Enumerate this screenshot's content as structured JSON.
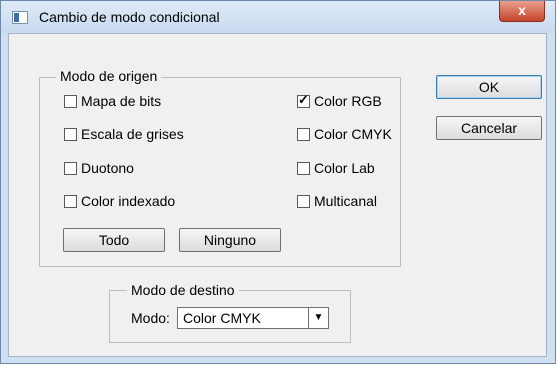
{
  "window": {
    "title": "Cambio de modo condicional",
    "close_glyph": "x"
  },
  "source_mode": {
    "legend": "Modo de origen",
    "left_options": [
      {
        "label": "Mapa de bits",
        "checked": false
      },
      {
        "label": "Escala de grises",
        "checked": false
      },
      {
        "label": "Duotono",
        "checked": false
      },
      {
        "label": "Color indexado",
        "checked": false
      }
    ],
    "right_options": [
      {
        "label": "Color RGB",
        "checked": true
      },
      {
        "label": "Color CMYK",
        "checked": false
      },
      {
        "label": "Color Lab",
        "checked": false
      },
      {
        "label": "Multicanal",
        "checked": false
      }
    ],
    "all_button": "Todo",
    "none_button": "Ninguno"
  },
  "target_mode": {
    "legend": "Modo de destino",
    "mode_label": "Modo:",
    "mode_value": "Color CMYK"
  },
  "actions": {
    "ok": "OK",
    "cancel": "Cancelar"
  }
}
